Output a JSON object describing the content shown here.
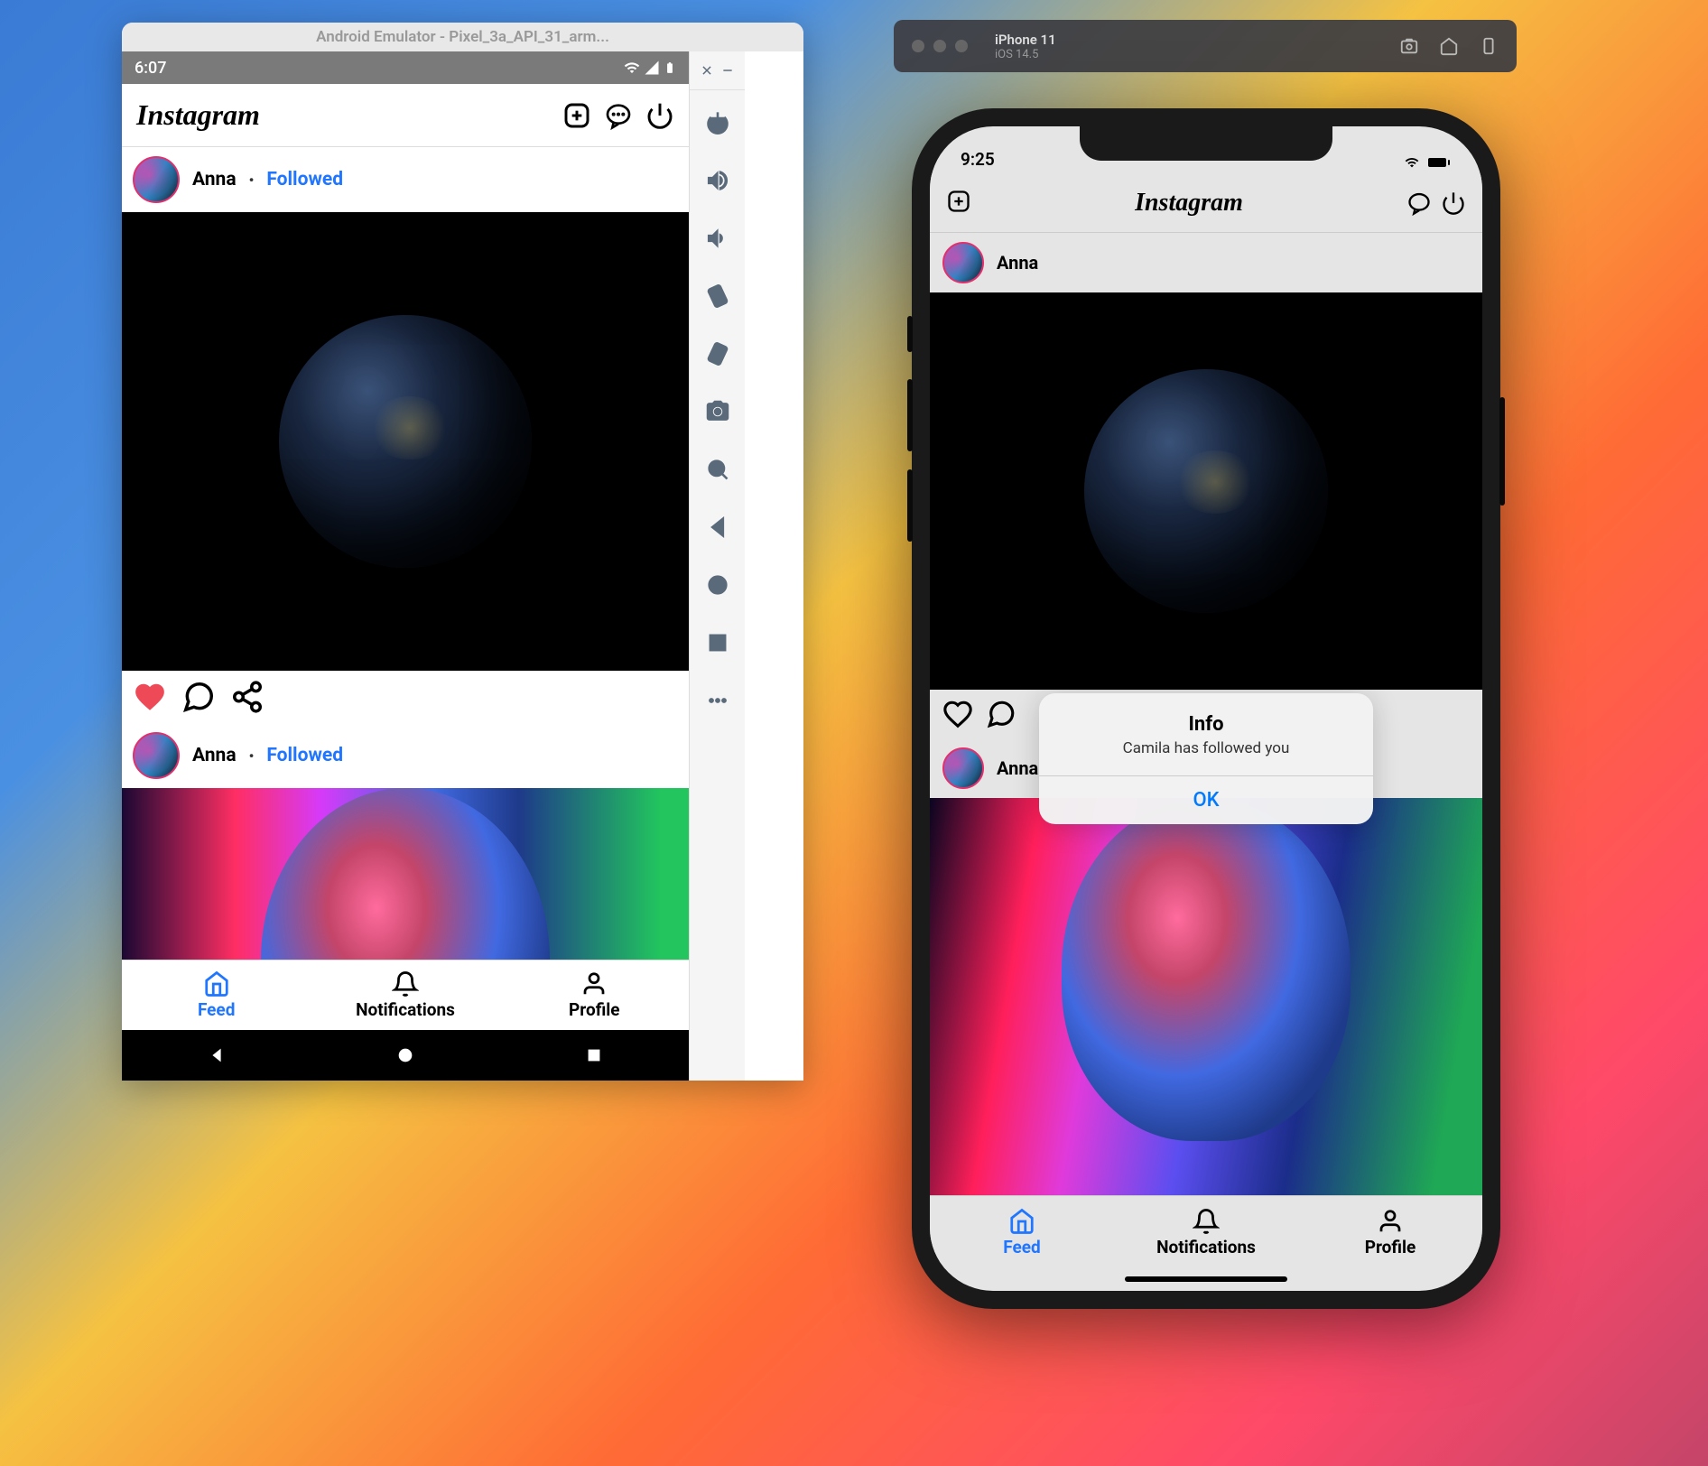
{
  "android": {
    "window_title": "Android Emulator - Pixel_3a_API_31_arm...",
    "status_time": "6:07",
    "app": {
      "logo": "Instagram",
      "posts": [
        {
          "username": "Anna",
          "follow_label": "Followed"
        },
        {
          "username": "Anna",
          "follow_label": "Followed"
        }
      ]
    },
    "tabs": {
      "feed": "Feed",
      "notifications": "Notifications",
      "profile": "Profile"
    }
  },
  "ios": {
    "toolbar": {
      "device_name": "iPhone 11",
      "os_version": "iOS 14.5"
    },
    "status_time": "9:25",
    "app": {
      "logo": "Instagram",
      "posts": [
        {
          "username": "Anna"
        },
        {
          "username": "Anna"
        }
      ]
    },
    "alert": {
      "title": "Info",
      "message": "Camila has followed you",
      "ok_label": "OK"
    },
    "tabs": {
      "feed": "Feed",
      "notifications": "Notifications",
      "profile": "Profile"
    }
  }
}
